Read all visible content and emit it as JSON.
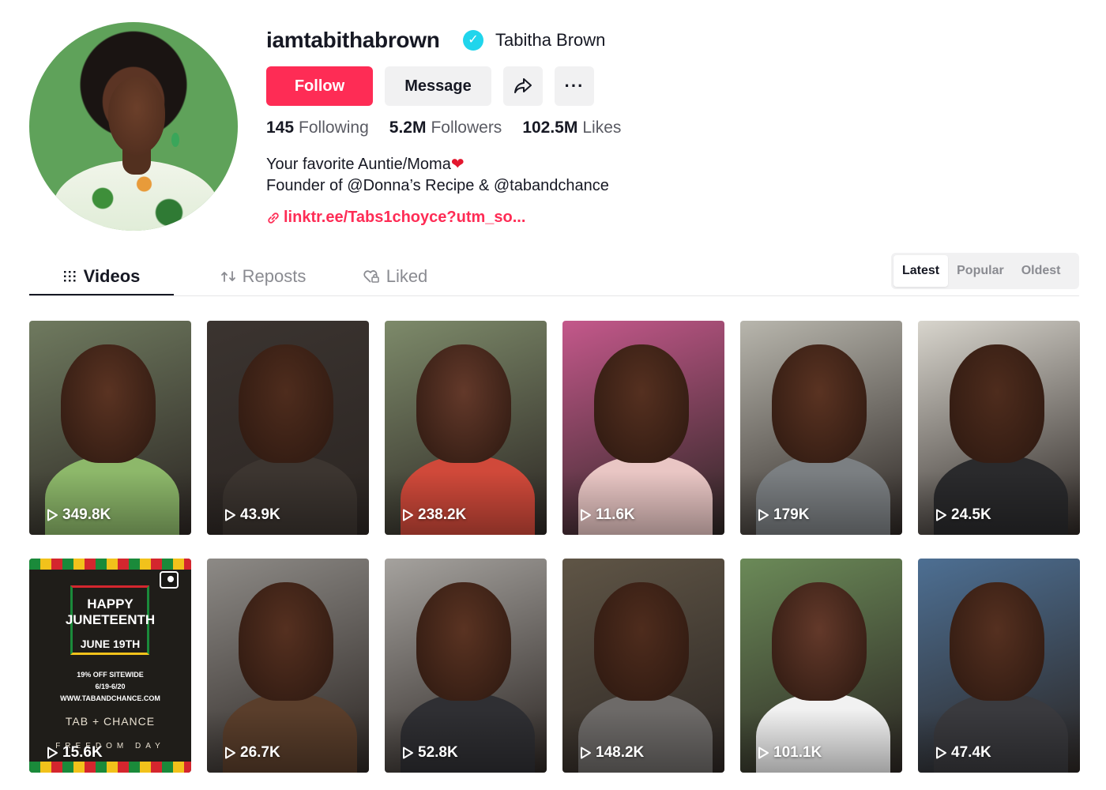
{
  "profile": {
    "username": "iamtabithabrown",
    "display_name": "Tabitha Brown",
    "verified_glyph": "✓",
    "buttons": {
      "follow": "Follow",
      "message": "Message",
      "more": "···"
    },
    "stats": [
      {
        "num": "145",
        "label": "Following"
      },
      {
        "num": "5.2M",
        "label": "Followers"
      },
      {
        "num": "102.5M",
        "label": "Likes"
      }
    ],
    "bio_line1": "Your favorite Auntie/Moma",
    "bio_heart": "❤",
    "bio_line2": "Founder of @Donna’s Recipe & @tabandchance",
    "link": "linktr.ee/Tabs1choyce?utm_so..."
  },
  "tabs": {
    "videos": "Videos",
    "reposts": "Reposts",
    "liked": "Liked"
  },
  "sort": {
    "options": [
      "Latest",
      "Popular",
      "Oldest"
    ],
    "selected": "Latest"
  },
  "videos": [
    {
      "views": "349.8K",
      "bg": "#6f7a5f"
    },
    {
      "views": "43.9K",
      "bg": "#3b3430"
    },
    {
      "views": "238.2K",
      "bg": "#7d8a6a"
    },
    {
      "views": "11.6K",
      "bg": "#c4588b"
    },
    {
      "views": "179K",
      "bg": "#b8b6ad"
    },
    {
      "views": "24.5K",
      "bg": "#d8d5cd"
    },
    {
      "views": "15.6K",
      "promo": true
    },
    {
      "views": "26.7K",
      "bg": "#8d8a86"
    },
    {
      "views": "52.8K",
      "bg": "#a5a29e"
    },
    {
      "views": "148.2K",
      "bg": "#5f5546"
    },
    {
      "views": "101.1K",
      "bg": "#6b8a58"
    },
    {
      "views": "47.4K",
      "bg": "#4d6f93"
    }
  ],
  "promo_card": {
    "title1": "HAPPY",
    "title2": "JUNETEENTH",
    "date": "JUNE 19TH",
    "sale": "19% OFF SITEWIDE",
    "sale_dates": "6/19-6/20",
    "site": "WWW.TABANDCHANCE.COM",
    "brand": "TAB + CHANCE",
    "footer": "FREEDOM DAY"
  },
  "colors": {
    "accent": "#fe2c55",
    "verified": "#20d5ec",
    "text": "#161823",
    "muted": "#8a8b91"
  }
}
